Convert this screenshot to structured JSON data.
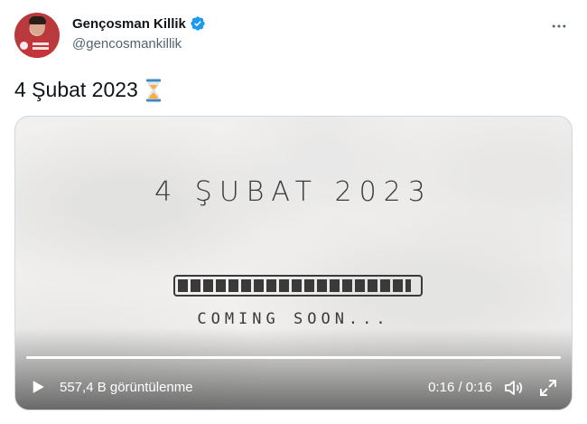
{
  "author": {
    "display_name": "Gençosman Killik",
    "handle": "@gencosmankillik",
    "verified_icon": "verified-badge-icon",
    "avatar": "profile-avatar",
    "more_icon": "more-options-icon"
  },
  "tweet": {
    "text": "4 Şubat 2023",
    "emoji": "hourglass-emoji"
  },
  "video": {
    "title_text": "4 ŞUBAT 2023",
    "loader_text": "COMING SOON...",
    "loader_progress": 0.97,
    "views": "557,4 B görüntülenme",
    "time": "0:16 / 0:16",
    "playback_progress": 1.0,
    "icons": {
      "play": "play-icon",
      "volume": "volume-icon",
      "fullscreen": "fullscreen-icon"
    }
  },
  "colors": {
    "accent_verified": "#1d9bf0",
    "text_primary": "#0f1419",
    "text_secondary": "#536471",
    "border": "#cfd9de"
  }
}
